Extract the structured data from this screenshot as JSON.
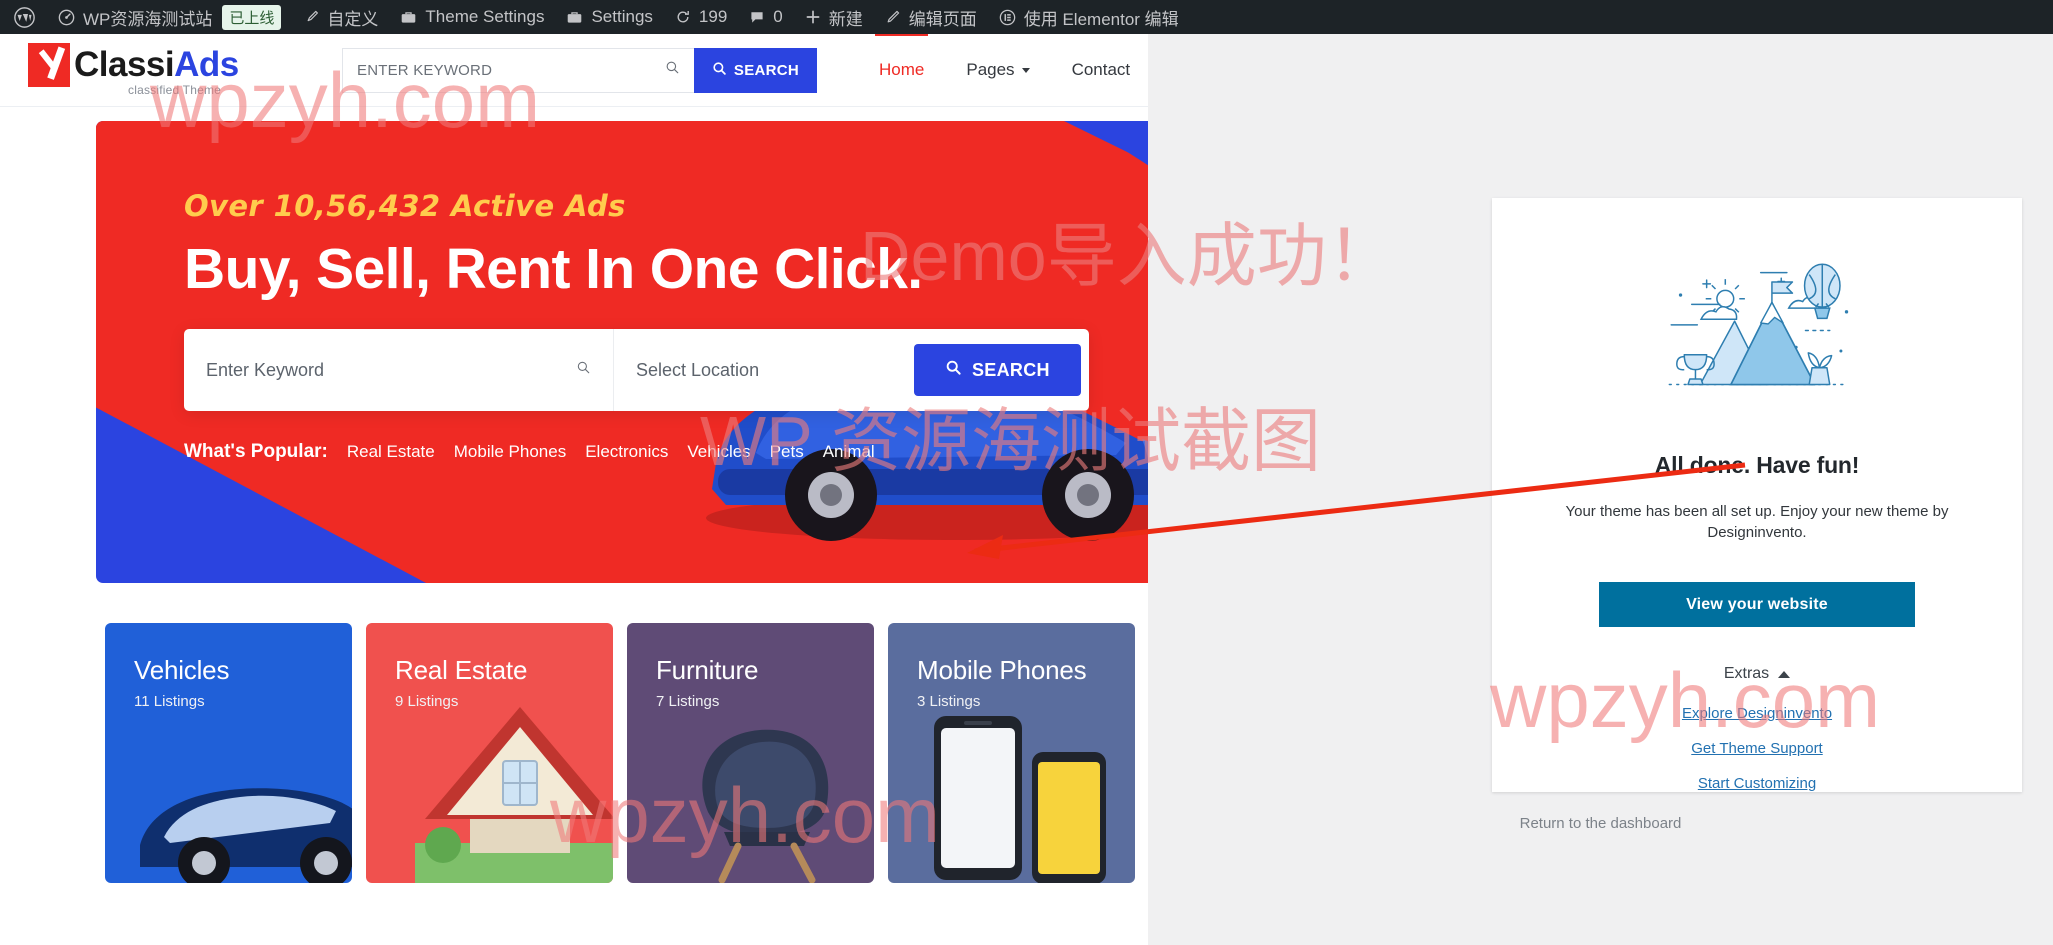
{
  "adminbar": {
    "wp_logo": "wordpress-icon",
    "items": [
      {
        "icon": "dashboard-icon",
        "label": "WP资源海测试站",
        "badge": "已上线"
      },
      {
        "icon": "paintbrush-icon",
        "label": "自定义"
      },
      {
        "icon": "briefcase-icon",
        "label": "Theme Settings"
      },
      {
        "icon": "briefcase-icon",
        "label": "Settings"
      },
      {
        "icon": "update-icon",
        "label": "199"
      },
      {
        "icon": "comment-icon",
        "label": "0"
      },
      {
        "icon": "plus-icon",
        "label": "新建"
      },
      {
        "icon": "pencil-icon",
        "label": "编辑页面"
      },
      {
        "icon": "elementor-icon",
        "label": "使用 Elementor 编辑"
      }
    ]
  },
  "site": {
    "logo": {
      "name_part1": "Classi",
      "name_part2": "Ads",
      "tagline": "classified Theme"
    },
    "header_search": {
      "placeholder": "ENTER KEYWORD",
      "value": "",
      "button_label": "SEARCH",
      "icon": "search-icon"
    },
    "nav": [
      {
        "label": "Home",
        "active": true,
        "has_dropdown": false
      },
      {
        "label": "Pages",
        "active": false,
        "has_dropdown": true
      },
      {
        "label": "Contact",
        "active": false,
        "has_dropdown": false
      }
    ],
    "hero": {
      "kicker": "Over 10,56,432 Active Ads",
      "title": "Buy, Sell, Rent In One Click.",
      "keyword_placeholder": "Enter Keyword",
      "keyword_value": "",
      "location_placeholder": "Select Location",
      "location_value": "",
      "search_button": "SEARCH",
      "popular_label": "What's Popular:",
      "popular_links": [
        "Real Estate",
        "Mobile Phones",
        "Electronics",
        "Vehicles",
        "Pets",
        "Animal"
      ],
      "colors": {
        "red": "#ef2a24",
        "blue": "#2b44e0",
        "kicker": "#ffcc4d"
      }
    },
    "categories": [
      {
        "title": "Vehicles",
        "count": "11 Listings",
        "color": "#2060d8"
      },
      {
        "title": "Real Estate",
        "count": "9 Listings",
        "color": "#f0514e"
      },
      {
        "title": "Furniture",
        "count": "7 Listings",
        "color": "#5f4b76"
      },
      {
        "title": "Mobile Phones",
        "count": "3 Listings",
        "color": "#5a6d9e"
      }
    ]
  },
  "admin": {
    "modal": {
      "illustration": "mountain-balloon-illustration",
      "title": "All done. Have fun!",
      "subtitle": "Your theme has been all set up. Enjoy your new theme by Designinvento.",
      "primary_button": "View your website",
      "extras_label": "Extras",
      "extras_icon": "chevron-up-icon",
      "extra_links": [
        "Explore Designinvento",
        "Get Theme Support",
        "Start Customizing"
      ],
      "accent_color": "#00709e",
      "link_color": "#2271b1"
    },
    "return_link": "Return to the dashboard"
  },
  "watermarks": {
    "w1": "wpzyh.com",
    "w2": "Demo导入成功！",
    "w3": "WP 资源海测试截图",
    "w4": "wpzyh.com",
    "w5": "wpzyh.com",
    "annotation_arrow": "red-arrow-annotation"
  }
}
